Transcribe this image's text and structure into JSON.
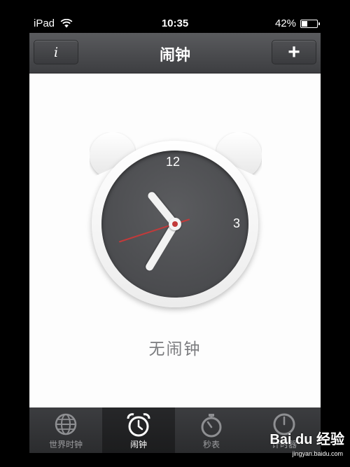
{
  "status_bar": {
    "device": "iPad",
    "time": "10:35",
    "battery_percent": "42%",
    "battery_level": 0.42
  },
  "nav": {
    "title": "闹钟",
    "info_label": "i",
    "add_label": "+"
  },
  "clock": {
    "numeral_12": "12",
    "numeral_3": "3"
  },
  "content": {
    "empty_message": "无闹钟"
  },
  "tabs": [
    {
      "label": "世界时钟",
      "icon": "globe-icon",
      "active": false
    },
    {
      "label": "闹钟",
      "icon": "alarm-clock-icon",
      "active": true
    },
    {
      "label": "秒表",
      "icon": "stopwatch-icon",
      "active": false
    },
    {
      "label": "计时器",
      "icon": "timer-icon",
      "active": false
    }
  ],
  "watermark": {
    "brand": "Bai du 经验",
    "url": "jingyan.baidu.com"
  },
  "colors": {
    "nav_bar": "#4a4b4e",
    "tab_bar": "#333436",
    "second_hand": "#c23a3a",
    "empty_text": "#7a7b7e"
  }
}
